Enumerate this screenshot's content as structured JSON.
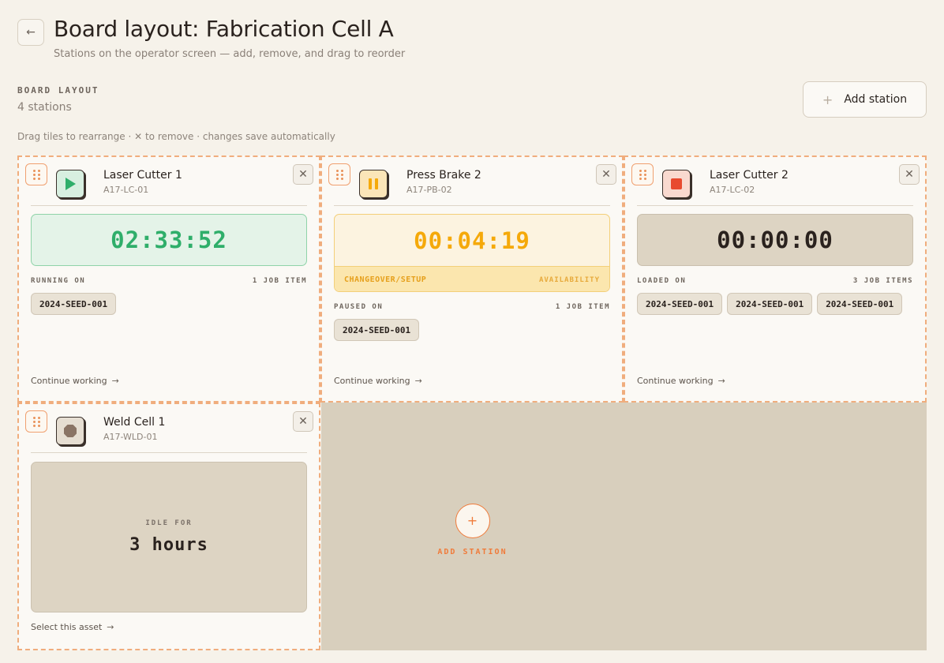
{
  "header": {
    "back_icon": "arrow-left-icon",
    "title": "Board layout: Fabrication Cell A",
    "subtitle": "Stations on the operator screen — add, remove, and drag to reorder"
  },
  "board": {
    "section_label": "BOARD LAYOUT",
    "count_text": "4 stations",
    "add_button_label": "Add station",
    "hint": "Drag tiles to rearrange · ✕ to remove · changes save automatically"
  },
  "stations": [
    {
      "name": "Laser Cutter 1",
      "code": "A17-LC-01",
      "status": "running",
      "status_icon": "play-icon",
      "timer": "02:33:52",
      "meta_left": "RUNNING ON",
      "meta_right": "1 JOB ITEM",
      "chips": [
        "2024-SEED-001"
      ],
      "footer": "Continue working"
    },
    {
      "name": "Press Brake 2",
      "code": "A17-PB-02",
      "status": "paused",
      "status_icon": "pause-icon",
      "timer": "00:04:19",
      "reason": "CHANGEOVER/SETUP",
      "reason_category": "AVAILABILITY",
      "meta_left": "PAUSED ON",
      "meta_right": "1 JOB ITEM",
      "chips": [
        "2024-SEED-001"
      ],
      "footer": "Continue working"
    },
    {
      "name": "Laser Cutter 2",
      "code": "A17-LC-02",
      "status": "stopped",
      "status_icon": "stop-icon",
      "timer": "00:00:00",
      "meta_left": "LOADED ON",
      "meta_right": "3 JOB ITEMS",
      "chips": [
        "2024-SEED-001",
        "2024-SEED-001",
        "2024-SEED-001"
      ],
      "footer": "Continue working"
    },
    {
      "name": "Weld Cell 1",
      "code": "A17-WLD-01",
      "status": "idle",
      "status_icon": "octagon-icon",
      "idle_label": "IDLE FOR",
      "idle_value": "3 hours",
      "footer": "Select this asset"
    }
  ],
  "empty_slot": {
    "label": "ADD STATION"
  },
  "colors": {
    "accent": "#f07b3a",
    "running": "#2fae6a",
    "paused": "#f5a90a",
    "stopped": "#e84a2f",
    "idle": "#8a7465"
  }
}
